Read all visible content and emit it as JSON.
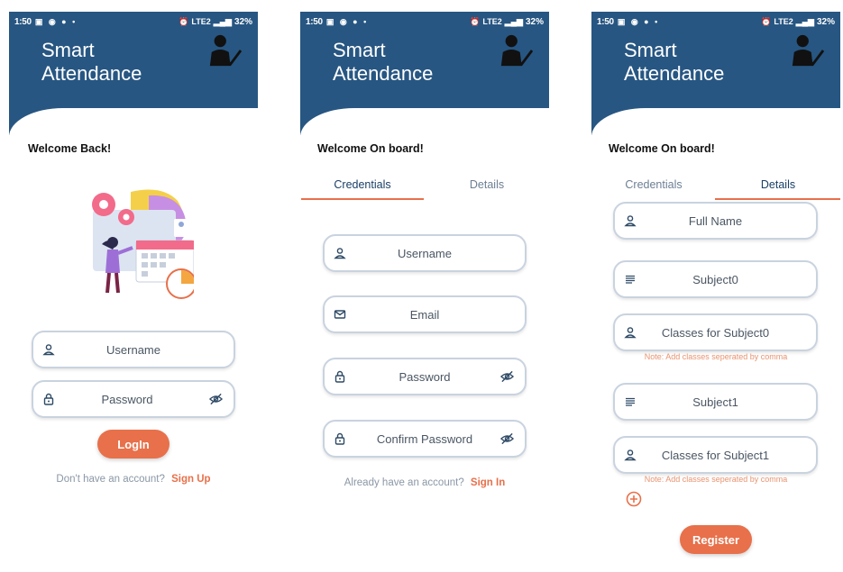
{
  "status_bar": {
    "time": "1:50",
    "battery": "32%",
    "net": "LTE2"
  },
  "app_title": "Smart\nAttendance",
  "login": {
    "welcome": "Welcome Back!",
    "username_placeholder": "Username",
    "password_placeholder": "Password",
    "login_button": "LogIn",
    "footer_text": "Don't have an account?",
    "footer_link": "Sign Up"
  },
  "signup_credentials": {
    "welcome": "Welcome On board!",
    "tabs": [
      "Credentials",
      "Details"
    ],
    "active_tab": "Credentials",
    "username_placeholder": "Username",
    "email_placeholder": "Email",
    "password_placeholder": "Password",
    "confirm_password_placeholder": "Confirm Password",
    "footer_text": "Already have an account?",
    "footer_link": "Sign In"
  },
  "signup_details": {
    "welcome": "Welcome On board!",
    "tabs": [
      "Credentials",
      "Details"
    ],
    "active_tab": "Details",
    "full_name_placeholder": "Full Name",
    "subject0_placeholder": "Subject0",
    "classes0_placeholder": "Classes for Subject0",
    "note0": "Note: Add classes seperated by comma",
    "subject1_placeholder": "Subject1",
    "classes1_placeholder": "Classes for Subject1",
    "note1": "Note: Add classes seperated by comma",
    "register_button": "Register"
  },
  "colors": {
    "primary": "#275682",
    "accent": "#e8704a",
    "field_border": "#c9d3df",
    "muted_text": "#8a97a6"
  }
}
